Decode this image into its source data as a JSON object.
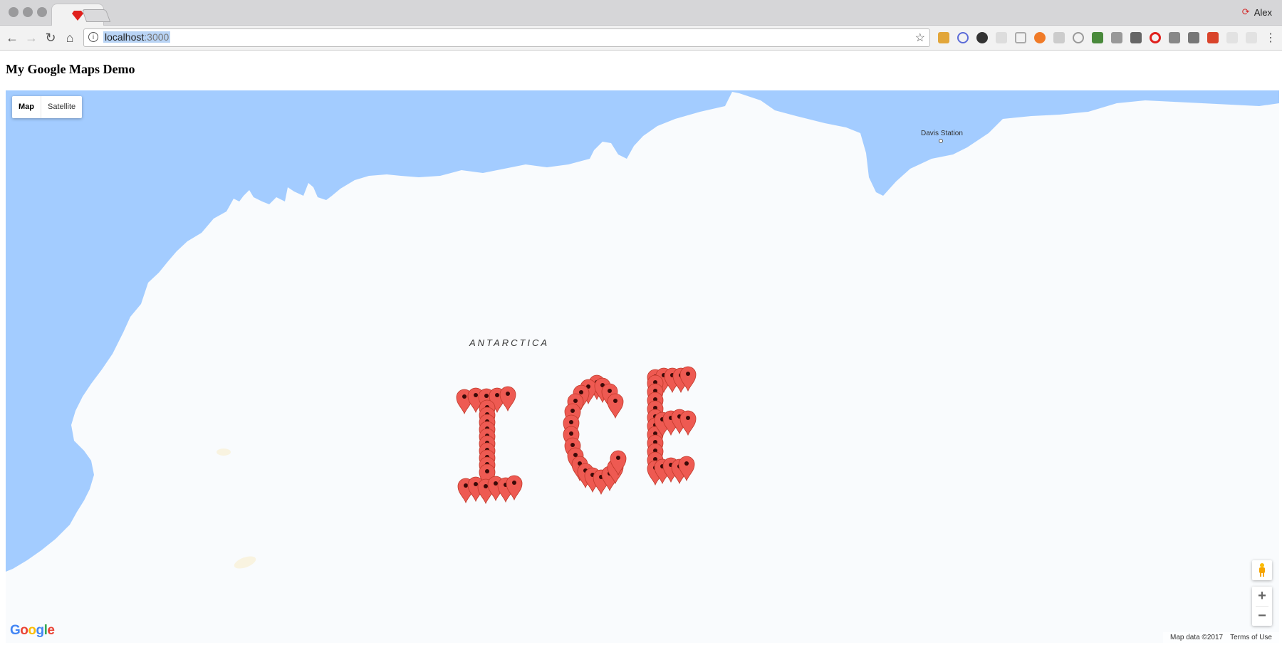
{
  "browser": {
    "profile_name": "Alex",
    "url_host": "localhost",
    "url_port": ":3000"
  },
  "page": {
    "title": "My Google Maps Demo"
  },
  "map": {
    "type_controls": [
      "Map",
      "Satellite"
    ],
    "active_type": "Map",
    "continent_label": "ANTARCTICA",
    "station_label": "Davis Station",
    "attribution": "Map data ©2017",
    "terms": "Terms of Use",
    "zoom_in": "+",
    "zoom_out": "−",
    "logo_letters": [
      "G",
      "o",
      "o",
      "g",
      "l",
      "e"
    ],
    "logo_colors": [
      "#4285f4",
      "#ea4335",
      "#fbbc05",
      "#4285f4",
      "#34a853",
      "#ea4335"
    ],
    "marker_color": "#ee5a52",
    "water_color": "#a3ccff",
    "land_color": "#f9fbfd",
    "marker_text": "ICE"
  }
}
